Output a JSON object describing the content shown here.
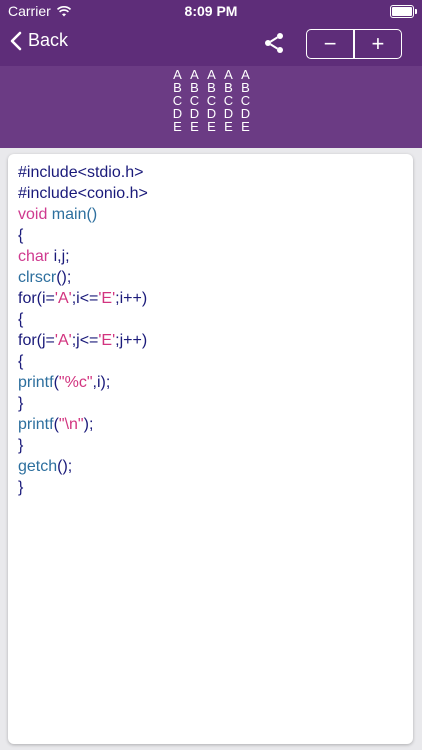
{
  "status": {
    "carrier": "Carrier",
    "time": "8:09 PM"
  },
  "nav": {
    "back_label": "Back",
    "icons": [
      "chevron-left-icon",
      "share-icon",
      "minus-icon",
      "plus-icon"
    ],
    "stepper_minus": "−",
    "stepper_plus": "+"
  },
  "output_pattern": [
    [
      "A",
      "B",
      "C",
      "D",
      "E"
    ],
    [
      "A",
      "B",
      "C",
      "D",
      "E"
    ],
    [
      "A",
      "B",
      "C",
      "D",
      "E"
    ],
    [
      "A",
      "B",
      "C",
      "D",
      "E"
    ],
    [
      "A",
      "B",
      "C",
      "D",
      "E"
    ]
  ],
  "code": {
    "lines": [
      [
        {
          "t": "#include<stdio.h>",
          "c": "dark"
        }
      ],
      [
        {
          "t": "#include<conio.h>",
          "c": "dark"
        }
      ],
      [
        {
          "t": "void",
          "c": "k"
        },
        {
          "t": " main()",
          "c": "fn"
        }
      ],
      [
        {
          "t": "{",
          "c": "dark"
        }
      ],
      [
        {
          "t": "char",
          "c": "k"
        },
        {
          "t": " i,j;",
          "c": "dark"
        }
      ],
      [
        {
          "t": "clrscr",
          "c": "fn"
        },
        {
          "t": "();",
          "c": "dark"
        }
      ],
      [
        {
          "t": "for",
          "c": "dark"
        },
        {
          "t": "(i=",
          "c": "dark"
        },
        {
          "t": "'A'",
          "c": "str"
        },
        {
          "t": ";i<=",
          "c": "dark"
        },
        {
          "t": "'E'",
          "c": "str"
        },
        {
          "t": ";i++)",
          "c": "dark"
        }
      ],
      [
        {
          "t": "{",
          "c": "dark"
        }
      ],
      [
        {
          "t": "for",
          "c": "dark"
        },
        {
          "t": "(j=",
          "c": "dark"
        },
        {
          "t": "'A'",
          "c": "str"
        },
        {
          "t": ";j<=",
          "c": "dark"
        },
        {
          "t": "'E'",
          "c": "str"
        },
        {
          "t": ";j++)",
          "c": "dark"
        }
      ],
      [
        {
          "t": "{",
          "c": "dark"
        }
      ],
      [
        {
          "t": "printf",
          "c": "fn"
        },
        {
          "t": "(",
          "c": "dark"
        },
        {
          "t": "\"%c\"",
          "c": "str"
        },
        {
          "t": ",i);",
          "c": "dark"
        }
      ],
      [
        {
          "t": "}",
          "c": "dark"
        }
      ],
      [
        {
          "t": "printf",
          "c": "fn"
        },
        {
          "t": "(",
          "c": "dark"
        },
        {
          "t": "\"\\n\"",
          "c": "str"
        },
        {
          "t": ");",
          "c": "dark"
        }
      ],
      [
        {
          "t": "}",
          "c": "dark"
        }
      ],
      [
        {
          "t": "getch",
          "c": "fn"
        },
        {
          "t": "();",
          "c": "dark"
        }
      ],
      [
        {
          "t": "}",
          "c": "dark"
        }
      ]
    ]
  },
  "colors": {
    "nav_bg": "#5e2d79",
    "preview_bg": "#6b3b84",
    "keyword": "#cf3a8f",
    "function": "#2d6f9e",
    "string": "#d2347f",
    "text": "#1a1a7a"
  }
}
